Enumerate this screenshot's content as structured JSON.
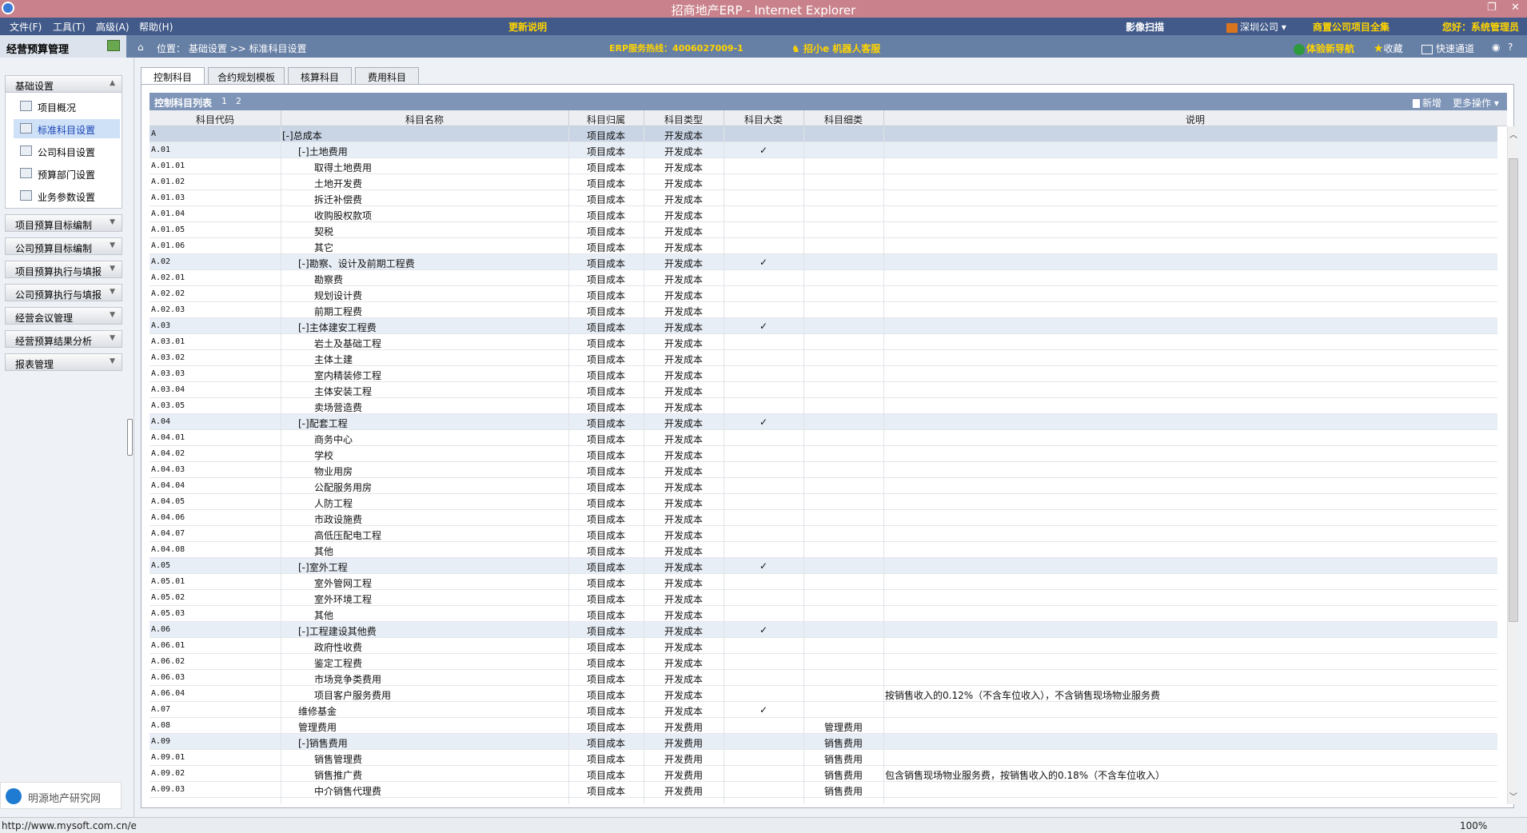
{
  "window": {
    "title": "招商地产ERP - Internet Explorer",
    "restore": "❐",
    "close": "✕"
  },
  "menubar": {
    "menus": [
      "文件(F)",
      "工具(T)",
      "高级(A)",
      "帮助(H)"
    ],
    "update_notes": "更新说明",
    "image_scan": "影像扫描",
    "company": "深圳公司 ▾",
    "projects_all": "商置公司项目全集",
    "greeting": "您好：系统管理员"
  },
  "navbar": {
    "section_title": "经营预算管理",
    "location": "位置： 基础设置 >> 标准科目设置",
    "hotline": "ERP服务热线：4006027009-1",
    "robot": "招小e 机器人客服",
    "tour": "体验新导航",
    "favorites": "收藏",
    "quick": "快速通道"
  },
  "sidebar": {
    "basic_settings": "基础设置",
    "sub_items": [
      "项目概况",
      "标准科目设置",
      "公司科目设置",
      "预算部门设置",
      "业务参数设置"
    ],
    "active_index": 1,
    "groups": [
      "项目预算目标编制",
      "公司预算目标编制",
      "项目预算执行与填报",
      "公司预算执行与填报",
      "经营会议管理",
      "经营预算结果分析",
      "报表管理"
    ],
    "logo_text": "明源地产研究网"
  },
  "tabs": [
    "控制科目",
    "合约规划模板",
    "核算科目",
    "费用科目"
  ],
  "grid": {
    "title": "控制科目列表",
    "pages": [
      "1",
      "2"
    ],
    "new_label": "新增",
    "more_label": "更多操作 ▾",
    "columns": [
      "科目代码",
      "科目名称",
      "科目归属",
      "科目类型",
      "科目大类",
      "科目细类",
      "说明"
    ],
    "rows": [
      {
        "code": "A",
        "name": "[-]总成本",
        "level": 0,
        "owner": "项目成本",
        "type": "开发成本",
        "big": "",
        "small": "",
        "desc": ""
      },
      {
        "code": "A.01",
        "name": "[-]土地费用",
        "level": 1,
        "owner": "项目成本",
        "type": "开发成本",
        "big": "✓",
        "small": "",
        "desc": ""
      },
      {
        "code": "A.01.01",
        "name": "取得土地费用",
        "level": 2,
        "owner": "项目成本",
        "type": "开发成本",
        "big": "",
        "small": "",
        "desc": ""
      },
      {
        "code": "A.01.02",
        "name": "土地开发费",
        "level": 2,
        "owner": "项目成本",
        "type": "开发成本",
        "big": "",
        "small": "",
        "desc": ""
      },
      {
        "code": "A.01.03",
        "name": "拆迁补偿费",
        "level": 2,
        "owner": "项目成本",
        "type": "开发成本",
        "big": "",
        "small": "",
        "desc": ""
      },
      {
        "code": "A.01.04",
        "name": "收购股权款项",
        "level": 2,
        "owner": "项目成本",
        "type": "开发成本",
        "big": "",
        "small": "",
        "desc": ""
      },
      {
        "code": "A.01.05",
        "name": "契税",
        "level": 2,
        "owner": "项目成本",
        "type": "开发成本",
        "big": "",
        "small": "",
        "desc": ""
      },
      {
        "code": "A.01.06",
        "name": "其它",
        "level": 2,
        "owner": "项目成本",
        "type": "开发成本",
        "big": "",
        "small": "",
        "desc": ""
      },
      {
        "code": "A.02",
        "name": "[-]勘察、设计及前期工程费",
        "level": 1,
        "owner": "项目成本",
        "type": "开发成本",
        "big": "✓",
        "small": "",
        "desc": ""
      },
      {
        "code": "A.02.01",
        "name": "勘察费",
        "level": 2,
        "owner": "项目成本",
        "type": "开发成本",
        "big": "",
        "small": "",
        "desc": ""
      },
      {
        "code": "A.02.02",
        "name": "规划设计费",
        "level": 2,
        "owner": "项目成本",
        "type": "开发成本",
        "big": "",
        "small": "",
        "desc": ""
      },
      {
        "code": "A.02.03",
        "name": "前期工程费",
        "level": 2,
        "owner": "项目成本",
        "type": "开发成本",
        "big": "",
        "small": "",
        "desc": ""
      },
      {
        "code": "A.03",
        "name": "[-]主体建安工程费",
        "level": 1,
        "owner": "项目成本",
        "type": "开发成本",
        "big": "✓",
        "small": "",
        "desc": ""
      },
      {
        "code": "A.03.01",
        "name": "岩土及基础工程",
        "level": 2,
        "owner": "项目成本",
        "type": "开发成本",
        "big": "",
        "small": "",
        "desc": ""
      },
      {
        "code": "A.03.02",
        "name": "主体土建",
        "level": 2,
        "owner": "项目成本",
        "type": "开发成本",
        "big": "",
        "small": "",
        "desc": ""
      },
      {
        "code": "A.03.03",
        "name": "室内精装修工程",
        "level": 2,
        "owner": "项目成本",
        "type": "开发成本",
        "big": "",
        "small": "",
        "desc": ""
      },
      {
        "code": "A.03.04",
        "name": "主体安装工程",
        "level": 2,
        "owner": "项目成本",
        "type": "开发成本",
        "big": "",
        "small": "",
        "desc": ""
      },
      {
        "code": "A.03.05",
        "name": "卖场营造费",
        "level": 2,
        "owner": "项目成本",
        "type": "开发成本",
        "big": "",
        "small": "",
        "desc": ""
      },
      {
        "code": "A.04",
        "name": "[-]配套工程",
        "level": 1,
        "owner": "项目成本",
        "type": "开发成本",
        "big": "✓",
        "small": "",
        "desc": ""
      },
      {
        "code": "A.04.01",
        "name": "商务中心",
        "level": 2,
        "owner": "项目成本",
        "type": "开发成本",
        "big": "",
        "small": "",
        "desc": ""
      },
      {
        "code": "A.04.02",
        "name": "学校",
        "level": 2,
        "owner": "项目成本",
        "type": "开发成本",
        "big": "",
        "small": "",
        "desc": ""
      },
      {
        "code": "A.04.03",
        "name": "物业用房",
        "level": 2,
        "owner": "项目成本",
        "type": "开发成本",
        "big": "",
        "small": "",
        "desc": ""
      },
      {
        "code": "A.04.04",
        "name": "公配服务用房",
        "level": 2,
        "owner": "项目成本",
        "type": "开发成本",
        "big": "",
        "small": "",
        "desc": ""
      },
      {
        "code": "A.04.05",
        "name": "人防工程",
        "level": 2,
        "owner": "项目成本",
        "type": "开发成本",
        "big": "",
        "small": "",
        "desc": ""
      },
      {
        "code": "A.04.06",
        "name": "市政设施费",
        "level": 2,
        "owner": "项目成本",
        "type": "开发成本",
        "big": "",
        "small": "",
        "desc": ""
      },
      {
        "code": "A.04.07",
        "name": "高低压配电工程",
        "level": 2,
        "owner": "项目成本",
        "type": "开发成本",
        "big": "",
        "small": "",
        "desc": ""
      },
      {
        "code": "A.04.08",
        "name": "其他",
        "level": 2,
        "owner": "项目成本",
        "type": "开发成本",
        "big": "",
        "small": "",
        "desc": ""
      },
      {
        "code": "A.05",
        "name": "[-]室外工程",
        "level": 1,
        "owner": "项目成本",
        "type": "开发成本",
        "big": "✓",
        "small": "",
        "desc": ""
      },
      {
        "code": "A.05.01",
        "name": "室外管网工程",
        "level": 2,
        "owner": "项目成本",
        "type": "开发成本",
        "big": "",
        "small": "",
        "desc": ""
      },
      {
        "code": "A.05.02",
        "name": "室外环境工程",
        "level": 2,
        "owner": "项目成本",
        "type": "开发成本",
        "big": "",
        "small": "",
        "desc": ""
      },
      {
        "code": "A.05.03",
        "name": "其他",
        "level": 2,
        "owner": "项目成本",
        "type": "开发成本",
        "big": "",
        "small": "",
        "desc": ""
      },
      {
        "code": "A.06",
        "name": "[-]工程建设其他费",
        "level": 1,
        "owner": "项目成本",
        "type": "开发成本",
        "big": "✓",
        "small": "",
        "desc": ""
      },
      {
        "code": "A.06.01",
        "name": "政府性收费",
        "level": 2,
        "owner": "项目成本",
        "type": "开发成本",
        "big": "",
        "small": "",
        "desc": ""
      },
      {
        "code": "A.06.02",
        "name": "鉴定工程费",
        "level": 2,
        "owner": "项目成本",
        "type": "开发成本",
        "big": "",
        "small": "",
        "desc": ""
      },
      {
        "code": "A.06.03",
        "name": "市场竞争类费用",
        "level": 2,
        "owner": "项目成本",
        "type": "开发成本",
        "big": "",
        "small": "",
        "desc": ""
      },
      {
        "code": "A.06.04",
        "name": "项目客户服务费用",
        "level": 2,
        "owner": "项目成本",
        "type": "开发成本",
        "big": "",
        "small": "",
        "desc": "按销售收入的0.12%（不含车位收入），不含销售现场物业服务费"
      },
      {
        "code": "A.07",
        "name": "维修基金",
        "level": 1,
        "owner": "项目成本",
        "type": "开发成本",
        "big": "✓",
        "small": "",
        "desc": ""
      },
      {
        "code": "A.08",
        "name": "管理费用",
        "level": 1,
        "owner": "项目成本",
        "type": "开发费用",
        "big": "",
        "small": "管理费用",
        "desc": ""
      },
      {
        "code": "A.09",
        "name": "[-]销售费用",
        "level": 1,
        "owner": "项目成本",
        "type": "开发费用",
        "big": "",
        "small": "销售费用",
        "desc": ""
      },
      {
        "code": "A.09.01",
        "name": "销售管理费",
        "level": 2,
        "owner": "项目成本",
        "type": "开发费用",
        "big": "",
        "small": "销售费用",
        "desc": ""
      },
      {
        "code": "A.09.02",
        "name": "销售推广费",
        "level": 2,
        "owner": "项目成本",
        "type": "开发费用",
        "big": "",
        "small": "销售费用",
        "desc": "包含销售现场物业服务费，按销售收入的0.18%（不含车位收入）"
      },
      {
        "code": "A.09.03",
        "name": "中介销售代理费",
        "level": 2,
        "owner": "项目成本",
        "type": "开发费用",
        "big": "",
        "small": "销售费用",
        "desc": ""
      }
    ]
  },
  "statusbar": {
    "url": "http://www.mysoft.com.cn/e",
    "zoom": "100%"
  },
  "colors": {
    "titlebar": "#c9828c",
    "menubar": "#425a8a",
    "navbar": "#667fa5",
    "accent_yellow": "#ffd400",
    "grid_header": "#7f95b8"
  }
}
